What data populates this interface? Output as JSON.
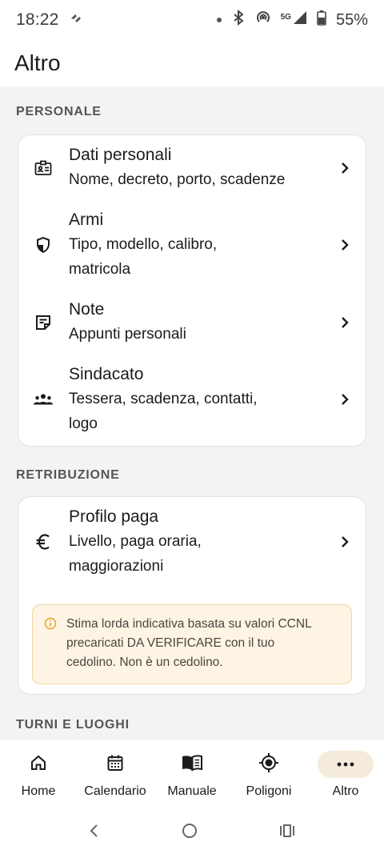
{
  "status_bar": {
    "time": "18:22",
    "network": "5G",
    "battery": "55%"
  },
  "app_bar": {
    "title": "Altro"
  },
  "sections": {
    "personale": {
      "title": "PERSONALE",
      "items": [
        {
          "title": "Dati personali",
          "subtitle": "Nome, decreto, porto, scadenze",
          "icon": "id-card-icon"
        },
        {
          "title": "Armi",
          "subtitle_lines": [
            "Tipo, modello, calibro,",
            "matricola"
          ],
          "icon": "shield-icon"
        },
        {
          "title": "Note",
          "subtitle": "Appunti personali",
          "icon": "note-icon"
        },
        {
          "title": "Sindacato",
          "subtitle_lines": [
            "Tessera, scadenza, contatti,",
            "logo"
          ],
          "icon": "group-icon"
        }
      ]
    },
    "retribuzione": {
      "title": "RETRIBUZIONE",
      "items": [
        {
          "title": "Profilo paga",
          "subtitle_lines": [
            "Livello, paga oraria,",
            "maggiorazioni"
          ],
          "icon": "euro-icon"
        }
      ],
      "info": {
        "lines": [
          "Stima lorda indicativa basata su valori CCNL",
          "precaricati DA VERIFICARE con il tuo",
          "cedolino. Non è un cedolino."
        ],
        "icon": "info-icon"
      }
    },
    "turni": {
      "title": "TURNI E LUOGHI"
    }
  },
  "bottom_nav": [
    {
      "label": "Home",
      "icon": "home-icon",
      "active": false
    },
    {
      "label": "Calendario",
      "icon": "calendar-icon",
      "active": false
    },
    {
      "label": "Manuale",
      "icon": "book-icon",
      "active": false
    },
    {
      "label": "Poligoni",
      "icon": "target-icon",
      "active": false
    },
    {
      "label": "Altro",
      "icon": "more-icon",
      "active": true
    }
  ],
  "colors": {
    "background": "#f4f3f3",
    "card": "#ffffff",
    "info_background": "#fdf4e3",
    "info_border": "#f1d7a8",
    "info_icon": "#e0a325",
    "active_nav": "#f5ebdc"
  }
}
